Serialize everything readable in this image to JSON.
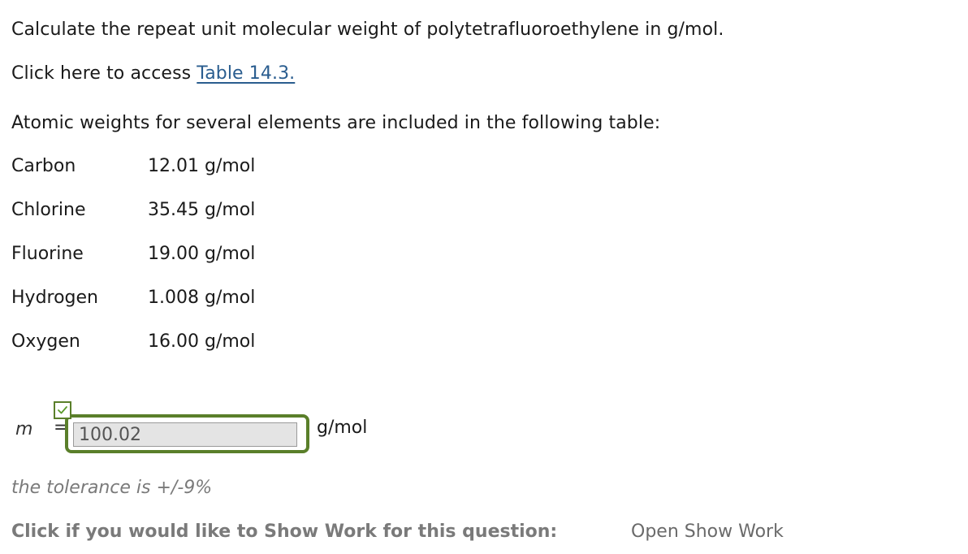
{
  "question": {
    "prompt": "Calculate the repeat unit molecular weight of polytetrafluoroethylene in g/mol.",
    "access_prefix": "Click here to access ",
    "access_link": "Table 14.3.",
    "table_intro": "Atomic weights for several elements are included in the following table:"
  },
  "elements": [
    {
      "name": "Carbon",
      "weight": "12.01 g/mol"
    },
    {
      "name": "Chlorine",
      "weight": "35.45 g/mol"
    },
    {
      "name": "Fluorine",
      "weight": "19.00 g/mol"
    },
    {
      "name": "Hydrogen",
      "weight": "1.008 g/mol"
    },
    {
      "name": "Oxygen",
      "weight": "16.00 g/mol"
    }
  ],
  "answer": {
    "variable": "m",
    "equals": "=",
    "value": "100.02",
    "unit": "g/mol",
    "status": "correct",
    "accent_color": "#5a7f2a",
    "status_icon": "check-icon"
  },
  "tolerance": "the tolerance is +/-9%",
  "show_work": {
    "label": "Click if you would like to Show Work for this question:",
    "link": "Open Show Work"
  }
}
